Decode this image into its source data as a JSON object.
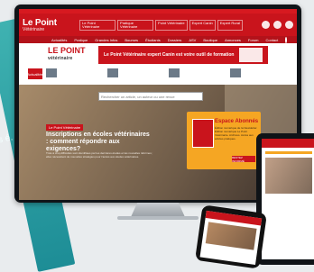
{
  "header": {
    "logo_title": "Le Point",
    "logo_sub": "Vétérinaire",
    "links": [
      "Le Point Vétérinaire",
      "Pratique Vétérinaire",
      "Point Vétérinaire",
      "Expert Canin",
      "Expert Rural"
    ]
  },
  "nav": {
    "items": [
      "Actualités",
      "Pratique",
      "Grandes Infos",
      "Bourses",
      "Étudiants",
      "Dossiers",
      "ASV",
      "Boutique",
      "Annonces",
      "Forum",
      "Contact"
    ]
  },
  "banner": {
    "logo_line1": "LE POINT",
    "logo_line2": "vétérinaire",
    "ad_text": "Le Point Vétérinaire expert Canin est votre outil de formation"
  },
  "news": {
    "sidebar_tag": "Actualités"
  },
  "hero": {
    "search_placeholder": "Rechercher un article, un auteur ou une revue",
    "tag": "Le Point Vétérinaire",
    "title": "Inscriptions en écoles vétérinaires : comment répondre aux exigences?",
    "text": "Trois à cinq difficultés sont identifiées par les dernières études et les nouvelles réformes; elles nécessitent de nouvelles stratégies pour l'accès aux études vétérinaires."
  },
  "subscription": {
    "title": "Espace Abonnés",
    "desc": "Édition numérique de la Newsletter. Édition numérique Le Point Vétérinaire. Archives. Accès aux articles pratiques.",
    "button": "RESTEZ INFORMÉ"
  },
  "bgcard": {
    "text": "s\né."
  }
}
